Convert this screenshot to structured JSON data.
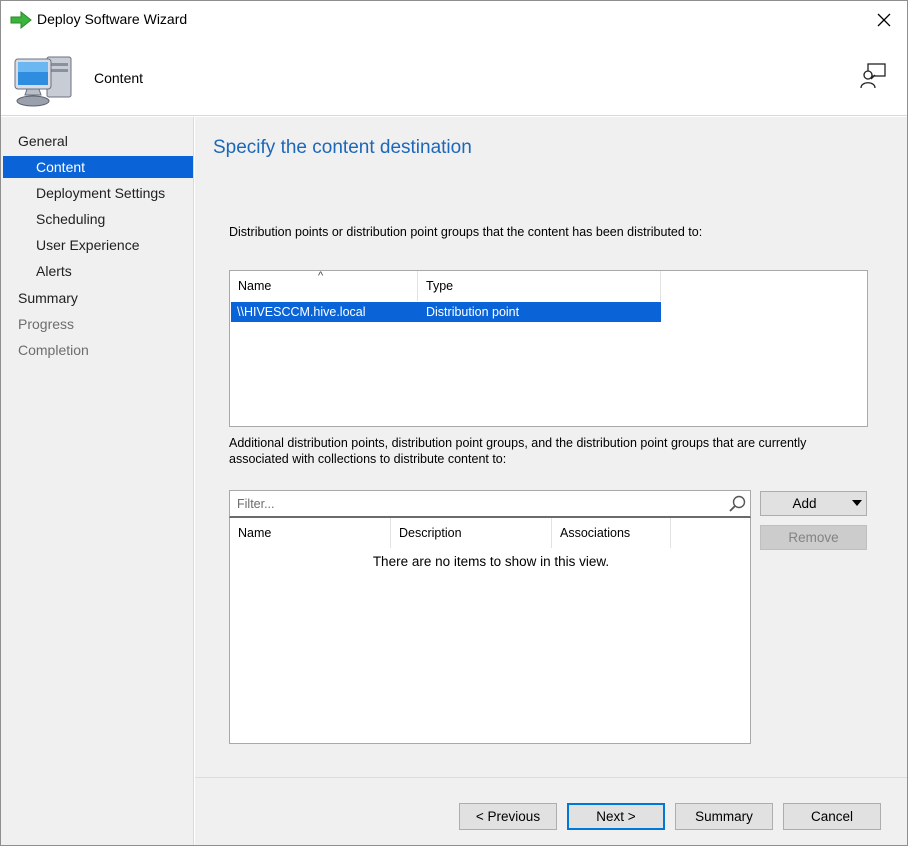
{
  "window": {
    "title": "Deploy Software Wizard",
    "icon": "green-arrow-icon"
  },
  "header": {
    "title": "Content",
    "icon": "computer-icon",
    "help_icon": "help-person-icon"
  },
  "sidebar": {
    "items": [
      {
        "label": "General",
        "state": "normal"
      },
      {
        "label": "Content",
        "state": "active"
      },
      {
        "label": "Deployment Settings",
        "state": "normal"
      },
      {
        "label": "Scheduling",
        "state": "normal"
      },
      {
        "label": "User Experience",
        "state": "normal"
      },
      {
        "label": "Alerts",
        "state": "normal"
      },
      {
        "label": "Summary",
        "state": "normal"
      },
      {
        "label": "Progress",
        "state": "disabled"
      },
      {
        "label": "Completion",
        "state": "disabled"
      }
    ]
  },
  "main": {
    "heading": "Specify the content destination",
    "distributed_label": "Distribution points or distribution point groups that the content has been distributed to:",
    "distributed_list": {
      "columns": [
        "Name",
        "Type"
      ],
      "rows": [
        {
          "name": "\\\\HIVESCCM.hive.local",
          "type": "Distribution point",
          "selected": true
        }
      ]
    },
    "additional_label": "Additional distribution points, distribution point groups, and the distribution point groups that are currently associated with collections to distribute content to:",
    "filter": {
      "placeholder": "Filter...",
      "value": ""
    },
    "additional_list": {
      "columns": [
        "Name",
        "Description",
        "Associations"
      ],
      "empty_message": "There are no items to show in this view."
    },
    "add_button": "Add",
    "remove_button": "Remove"
  },
  "footer": {
    "previous": "< Previous",
    "next": "Next >",
    "summary": "Summary",
    "cancel": "Cancel"
  },
  "colors": {
    "accent": "#0a64d8",
    "heading": "#1d67b9",
    "panel": "#f0f0f0"
  }
}
